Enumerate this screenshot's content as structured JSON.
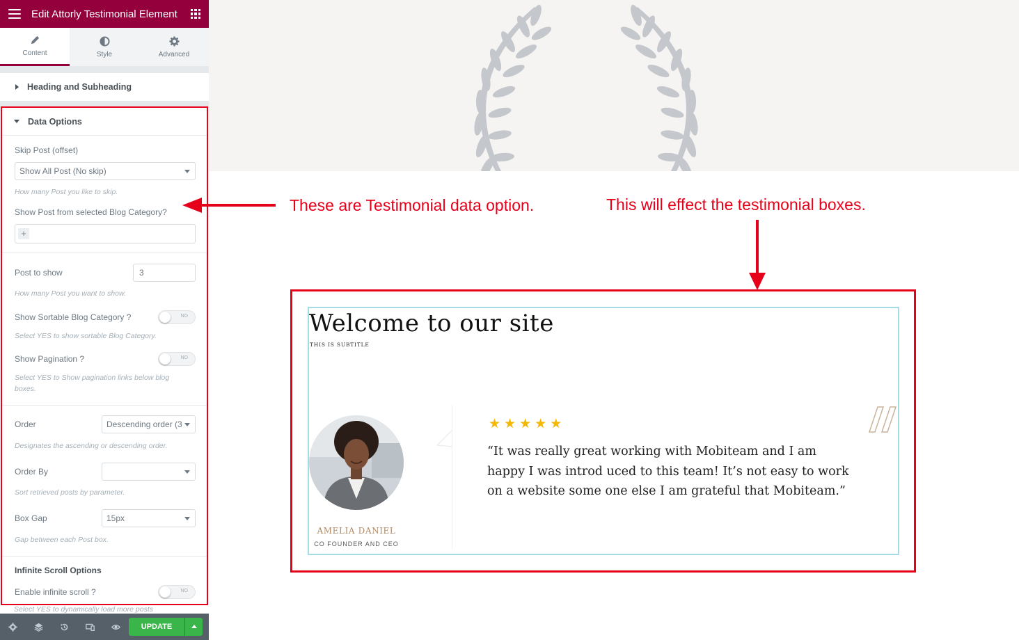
{
  "editor": {
    "title": "Edit Attorly Testimonial Element",
    "tabs": [
      {
        "label": "Content",
        "icon": "pencil-icon",
        "active": true
      },
      {
        "label": "Style",
        "icon": "contrast-icon",
        "active": false
      },
      {
        "label": "Advanced",
        "icon": "gear-icon",
        "active": false
      }
    ],
    "sections": {
      "heading": "Heading and Subheading",
      "data_options": "Data Options"
    },
    "controls": {
      "skip_post": {
        "label": "Skip Post (offset)",
        "value": "Show All Post (No skip)",
        "desc": "How many Post you like to skip."
      },
      "category": {
        "label": "Show Post from selected Blog Category?",
        "plus": "+"
      },
      "post_to_show": {
        "label": "Post to show",
        "value": "3",
        "desc": "How many Post you want to show."
      },
      "sortable": {
        "label": "Show Sortable Blog Category ?",
        "toggle": "NO",
        "desc": "Select YES to show sortable Blog Category."
      },
      "pagination": {
        "label": "Show Pagination ?",
        "toggle": "NO",
        "desc": "Select YES to Show pagination links below blog boxes."
      },
      "order": {
        "label": "Order",
        "value": "Descending order (3",
        "desc": "Designates the ascending or descending order."
      },
      "order_by": {
        "label": "Order By",
        "value": "",
        "desc": "Sort retrieved posts by parameter."
      },
      "box_gap": {
        "label": "Box Gap",
        "value": "15px",
        "desc": "Gap between each Post box."
      },
      "infinite": {
        "heading": "Infinite Scroll Options",
        "label": "Enable infinite scroll ?",
        "toggle": "NO",
        "desc": "Select YES to dynamically load more posts"
      }
    },
    "footer": {
      "icons": [
        "settings-icon",
        "layers-icon",
        "history-icon",
        "responsive-icon",
        "preview-icon"
      ],
      "update_label": "UPDATE"
    },
    "accent_color": "#93003c",
    "update_color": "#39b54a"
  },
  "annotations": {
    "left": "These are Testimonial data option.",
    "right": "This will effect the testimonial boxes.",
    "color": "#e6001a"
  },
  "testimonial": {
    "title": "Welcome to our site",
    "subtitle": "This is subtitle",
    "name": "Amelia Daniel",
    "role": "Co Founder and CEO",
    "rating": 5,
    "quote": "“It was really great working with Mobiteam and I am happy I was introd uced to this team! It’s not easy to work on a website some one else I am grateful that Mobiteam.”"
  }
}
